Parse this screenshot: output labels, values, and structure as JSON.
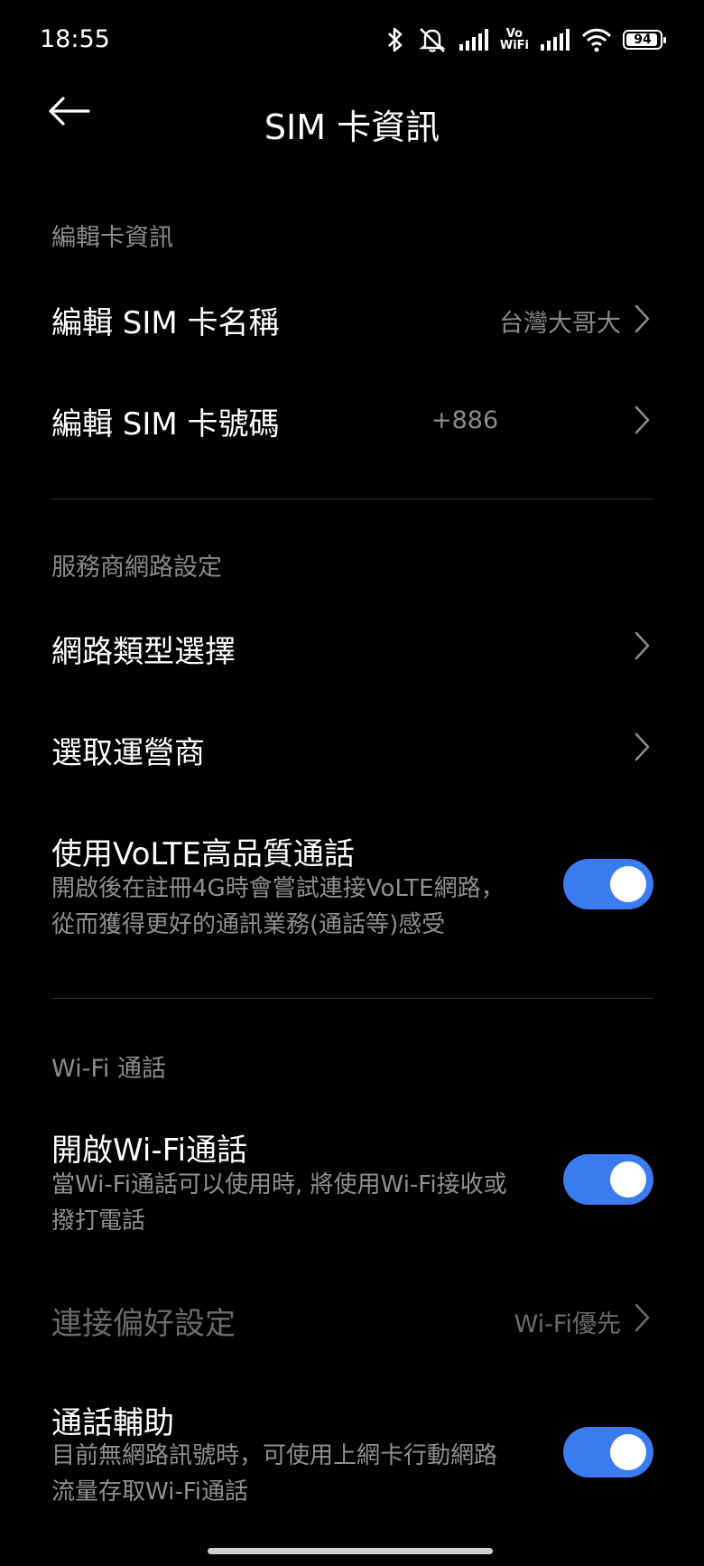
{
  "status_bar": {
    "time": "18:55",
    "vowifi_top": "Vo",
    "vowifi_bottom": "WiFi",
    "battery_percent": "94",
    "battery_level": 0.94
  },
  "header": {
    "title": "SIM 卡資訊"
  },
  "section_card": {
    "header": "編輯卡資訊",
    "edit_name_label": "編輯 SIM 卡名稱",
    "edit_name_value": "台灣大哥大",
    "edit_number_label": "編輯 SIM 卡號碼",
    "edit_number_value": "+886"
  },
  "section_network": {
    "header": "服務商網路設定",
    "network_type_label": "網路類型選擇",
    "operator_label": "選取運營商",
    "volte_label": "使用VoLTE高品質通話",
    "volte_desc_1": "開啟後在註冊4G時會嘗試連接VoLTE網路，",
    "volte_desc_2": "從而獲得更好的通訊業務(通話等)感受",
    "volte_enabled": true
  },
  "section_wifi": {
    "header": "Wi-Fi 通話",
    "wifi_call_label": "開啟Wi-Fi通話",
    "wifi_call_desc_1": "當Wi-Fi通話可以使用時, 將使用Wi-Fi接收或",
    "wifi_call_desc_2": "撥打電話",
    "wifi_call_enabled": true,
    "preference_label": "連接偏好設定",
    "preference_value": "Wi-Fi優先",
    "assist_label": "通話輔助",
    "assist_desc_1": "目前無網路訊號時，可使用上網卡行動網路",
    "assist_desc_2": "流量存取Wi-Fi通話",
    "assist_enabled": true
  },
  "colors": {
    "background": "#000000",
    "accent": "#3a7cf0",
    "secondary_text": "#8a8a8a"
  }
}
